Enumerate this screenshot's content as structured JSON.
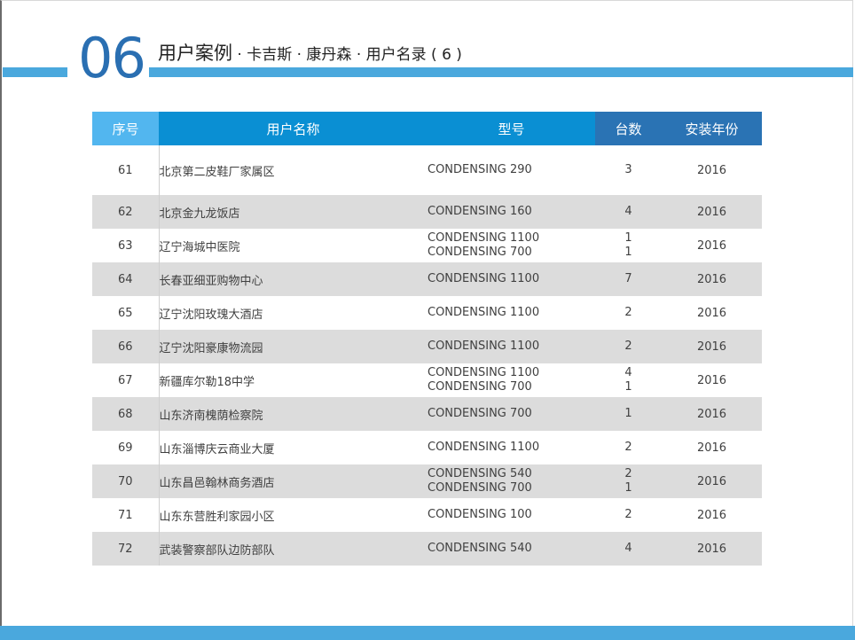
{
  "header": {
    "section_number": "06",
    "title_main": "用户案例",
    "title_sub": " · 卡吉斯 · 康丹森 · 用户名录 ( 6 )"
  },
  "table": {
    "columns": [
      "序号",
      "用户名称",
      "型号",
      "台数",
      "安装年份"
    ],
    "rows": [
      {
        "no": "61",
        "name": "北京第二皮鞋厂家属区",
        "models": [
          "CONDENSING 290"
        ],
        "qty": [
          "3"
        ],
        "year": "2016"
      },
      {
        "no": "62",
        "name": "北京金九龙饭店",
        "models": [
          "CONDENSING 160"
        ],
        "qty": [
          "4"
        ],
        "year": "2016"
      },
      {
        "no": "63",
        "name": "辽宁海城中医院",
        "models": [
          "CONDENSING 1100",
          "CONDENSING 700"
        ],
        "qty": [
          "1",
          "1"
        ],
        "year": "2016"
      },
      {
        "no": "64",
        "name": "长春亚细亚购物中心",
        "models": [
          "CONDENSING 1100"
        ],
        "qty": [
          "7"
        ],
        "year": "2016"
      },
      {
        "no": "65",
        "name": "辽宁沈阳玫瑰大酒店",
        "models": [
          "CONDENSING 1100"
        ],
        "qty": [
          "2"
        ],
        "year": "2016"
      },
      {
        "no": "66",
        "name": "辽宁沈阳豪康物流园",
        "models": [
          "CONDENSING 1100"
        ],
        "qty": [
          "2"
        ],
        "year": "2016"
      },
      {
        "no": "67",
        "name": "新疆库尔勒18中学",
        "models": [
          "CONDENSING 1100",
          "CONDENSING 700"
        ],
        "qty": [
          "4",
          "1"
        ],
        "year": "2016"
      },
      {
        "no": "68",
        "name": "山东济南槐荫检察院",
        "models": [
          "CONDENSING 700"
        ],
        "qty": [
          "1"
        ],
        "year": "2016"
      },
      {
        "no": "69",
        "name": "山东淄博庆云商业大厦",
        "models": [
          "CONDENSING 1100"
        ],
        "qty": [
          "2"
        ],
        "year": "2016"
      },
      {
        "no": "70",
        "name": "山东昌邑翰林商务酒店",
        "models": [
          "CONDENSING 540",
          "CONDENSING 700"
        ],
        "qty": [
          "2",
          "1"
        ],
        "year": "2016"
      },
      {
        "no": "71",
        "name": "山东东营胜利家园小区",
        "models": [
          "CONDENSING 100"
        ],
        "qty": [
          "2"
        ],
        "year": "2016"
      },
      {
        "no": "72",
        "name": "武装警察部队边防部队",
        "models": [
          "CONDENSING 540"
        ],
        "qty": [
          "4"
        ],
        "year": "2016"
      }
    ]
  }
}
